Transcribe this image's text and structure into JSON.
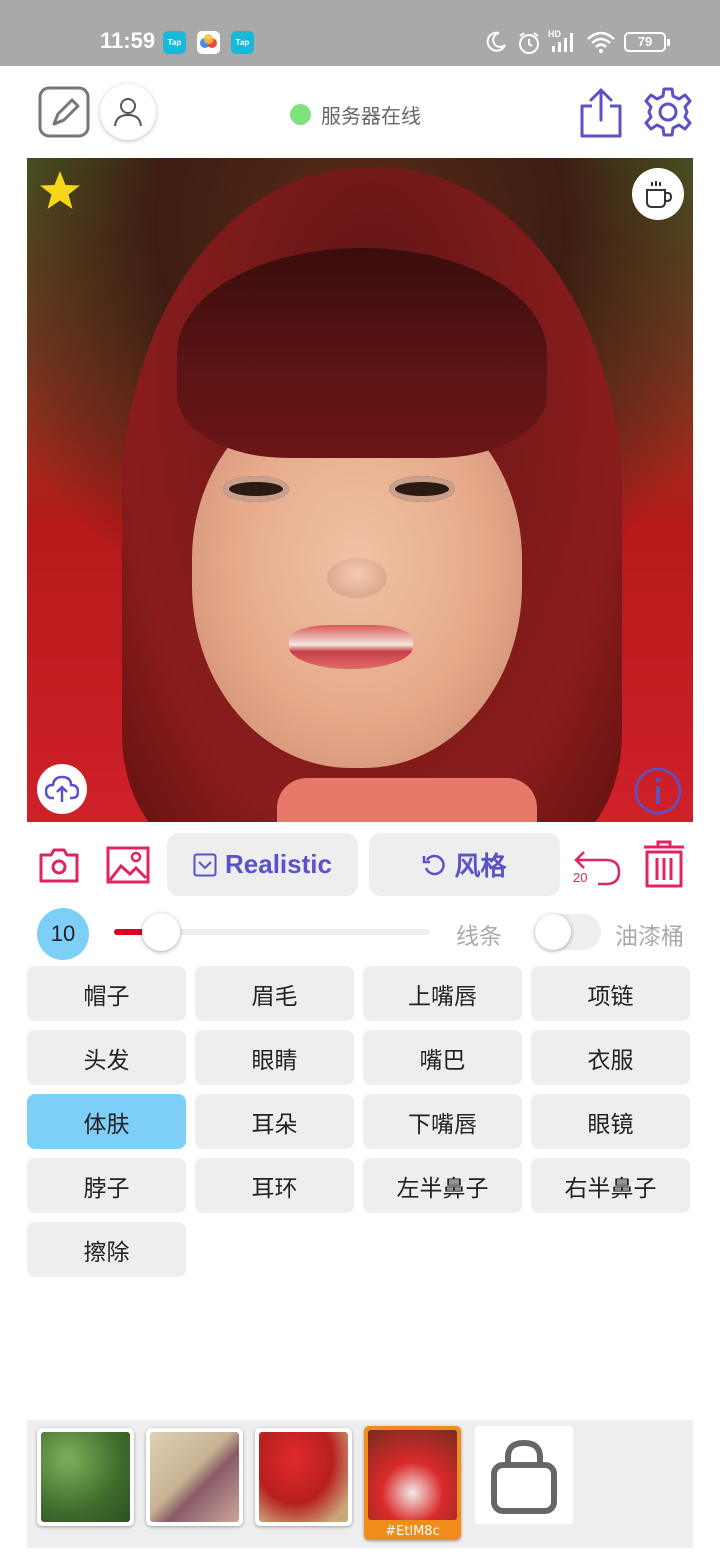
{
  "status_bar": {
    "time": "11:59",
    "apps": [
      "Tap",
      "",
      "Tap"
    ],
    "network_label": "HD",
    "battery": "79"
  },
  "header": {
    "server_status": "服务器在线",
    "accent_color": "#5b52c6",
    "online_color": "#7ee37e"
  },
  "toolbar": {
    "model_label": "Realistic",
    "style_label": "风格",
    "undo_count": "20"
  },
  "brush": {
    "size": "10",
    "size_fraction": 0.15,
    "line_label": "线条",
    "bucket_label": "油漆桶",
    "bucket_on": false
  },
  "parts": [
    {
      "label": "帽子",
      "active": false
    },
    {
      "label": "眉毛",
      "active": false
    },
    {
      "label": "上嘴唇",
      "active": false
    },
    {
      "label": "项链",
      "active": false
    },
    {
      "label": "头发",
      "active": false
    },
    {
      "label": "眼睛",
      "active": false
    },
    {
      "label": "嘴巴",
      "active": false
    },
    {
      "label": "衣服",
      "active": false
    },
    {
      "label": "体肤",
      "active": true
    },
    {
      "label": "耳朵",
      "active": false
    },
    {
      "label": "下嘴唇",
      "active": false
    },
    {
      "label": "眼镜",
      "active": false
    },
    {
      "label": "脖子",
      "active": false
    },
    {
      "label": "耳环",
      "active": false
    },
    {
      "label": "左半鼻子",
      "active": false
    },
    {
      "label": "右半鼻子",
      "active": false
    },
    {
      "label": "擦除",
      "active": false
    }
  ],
  "styles_tray": {
    "selected_tag": "#EtlM8c"
  }
}
